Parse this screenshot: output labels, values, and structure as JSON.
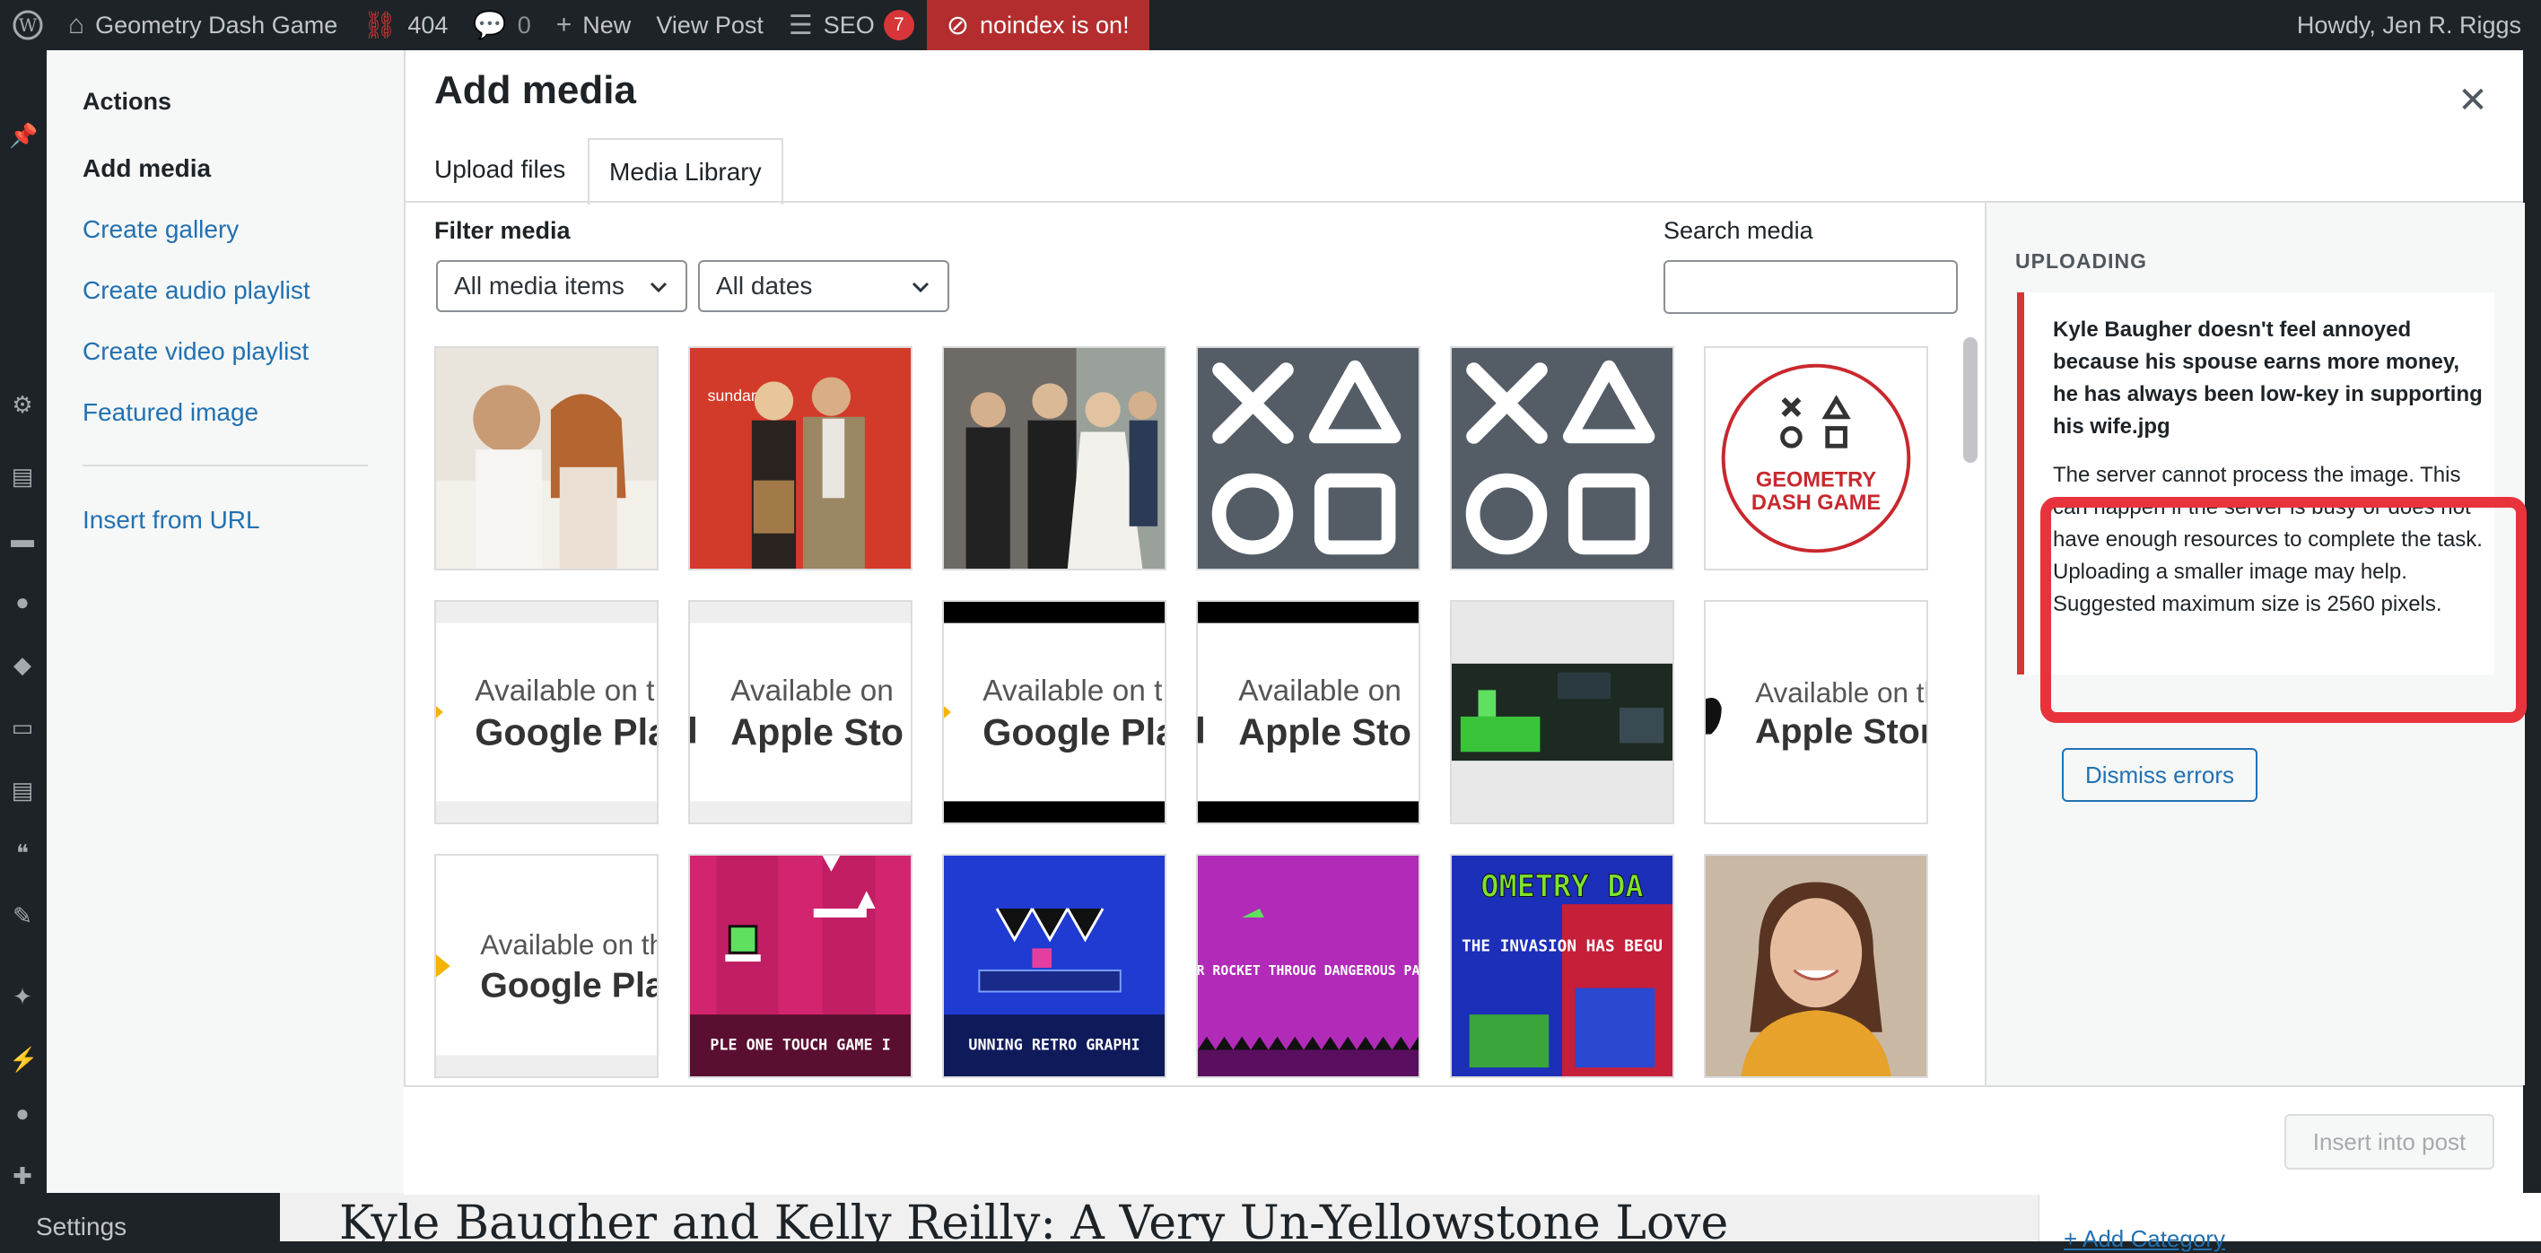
{
  "admin_bar": {
    "site_name": "Geometry Dash Game",
    "broken_links_count": "404",
    "comments_count": "0",
    "new_label": "New",
    "view_post_label": "View Post",
    "seo_label": "SEO",
    "seo_badge": "7",
    "noindex_label": "noindex is on!",
    "howdy": "Howdy, Jen R. Riggs"
  },
  "background_page": {
    "post_title": "Kyle Baugher and Kelly Reilly: A Very Un-Yellowstone Love",
    "settings_label": "Settings",
    "add_category_label": "+ Add Category"
  },
  "media_menu": {
    "heading": "Actions",
    "items": [
      {
        "label": "Add media",
        "active": true
      },
      {
        "label": "Create gallery"
      },
      {
        "label": "Create audio playlist"
      },
      {
        "label": "Create video playlist"
      },
      {
        "label": "Featured image"
      }
    ],
    "insert_url": "Insert from URL"
  },
  "frame": {
    "title": "Add media",
    "tabs": [
      {
        "label": "Upload files"
      },
      {
        "label": "Media Library",
        "active": true
      }
    ]
  },
  "toolbar": {
    "filter_label": "Filter media",
    "type_select": "All media items",
    "date_select": "All dates",
    "search_label": "Search media",
    "search_value": ""
  },
  "thumbnails": [
    {
      "label": "photo-couple-smiling"
    },
    {
      "label": "photo-red-carpet"
    },
    {
      "label": "photo-wedding"
    },
    {
      "label": "playstation-symbols"
    },
    {
      "label": "playstation-symbols"
    },
    {
      "label": "geometry-dash-logo",
      "text1": "GEOMETRY",
      "text2": "DASH GAME"
    },
    {
      "label": "badge",
      "line1": "Available on t",
      "line2": "Google Pla"
    },
    {
      "label": "badge",
      "line1": "Available on",
      "line2": "Apple Sto"
    },
    {
      "label": "badge",
      "line1": "Available on t",
      "line2": "Google Pla"
    },
    {
      "label": "badge",
      "line1": "Available on",
      "line2": "Apple Sto"
    },
    {
      "label": "game-screenshot-green"
    },
    {
      "label": "badge",
      "line1": "Available on th",
      "line2": "Apple Store"
    },
    {
      "label": "badge",
      "line1": "Available on th",
      "line2": "Google Play"
    },
    {
      "label": "game-pink",
      "caption": "PLE ONE TOUCH GAME I"
    },
    {
      "label": "game-blue",
      "caption": "UNNING RETRO GRAPHI"
    },
    {
      "label": "game-purple",
      "caption": "DE YOUR ROCKET THROUG DANGEROUS PASSAGES"
    },
    {
      "label": "game-title",
      "caption": "OMETRY DA",
      "caption2": "THE INVASION HAS BEGU"
    },
    {
      "label": "photo-woman-smiling"
    }
  ],
  "sidebar": {
    "heading": "UPLOADING",
    "error_file": "Kyle Baugher doesn't feel annoyed because his spouse earns more money, he has always been low-key in supporting his wife.jpg",
    "error_message": "The server cannot process the image. This can happen if the server is busy or does not have enough resources to complete the task. Uploading a smaller image may help. Suggested maximum size is 2560 pixels.",
    "dismiss_label": "Dismiss errors"
  },
  "footer": {
    "insert_label": "Insert into post"
  },
  "colors": {
    "link": "#2271b1",
    "error": "#d63638",
    "highlight": "#e8333c",
    "admin_bar": "#1d2327"
  }
}
